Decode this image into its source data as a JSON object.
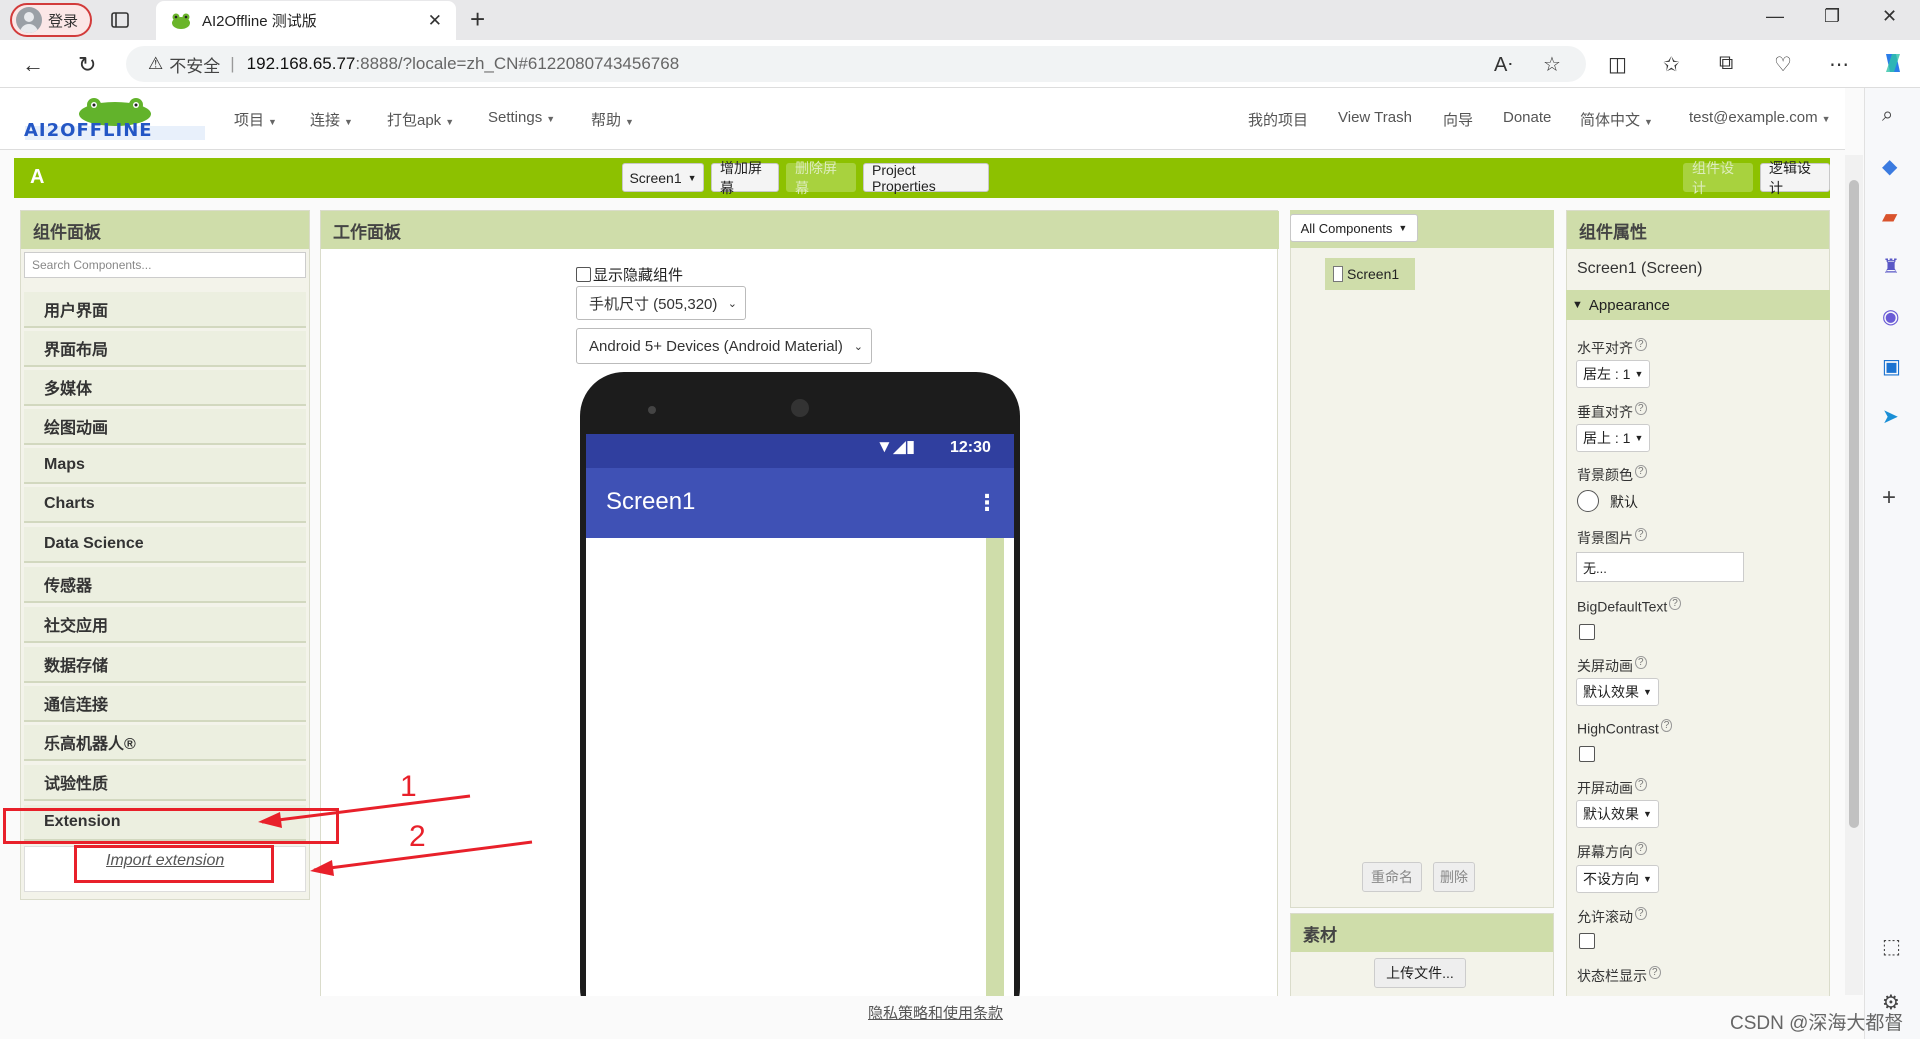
{
  "browser": {
    "profile": "登录",
    "tab_title": "AI2Offline 测试版",
    "url_insecure": "不安全",
    "url_host": "192.168.65.77",
    "url_path": ":8888/?locale=zh_CN#6122080743456768"
  },
  "appnav": {
    "logo": "AI2OFFLINE",
    "menus": [
      "项目",
      "连接",
      "打包apk",
      "Settings",
      "帮助"
    ],
    "right": [
      "我的项目",
      "View Trash",
      "向导",
      "Donate"
    ],
    "language": "简体中文",
    "user": "test@example.com"
  },
  "toolbar": {
    "project": "A",
    "screen": "Screen1",
    "add_screen": "增加屏幕",
    "remove_screen": "删除屏幕",
    "project_props": "Project Properties",
    "designer": "组件设计",
    "blocks": "逻辑设计"
  },
  "palette": {
    "title": "组件面板",
    "search_placeholder": "Search Components...",
    "categories": [
      "用户界面",
      "界面布局",
      "多媒体",
      "绘图动画",
      "Maps",
      "Charts",
      "Data Science",
      "传感器",
      "社交应用",
      "数据存储",
      "通信连接",
      "乐高机器人®",
      "试验性质",
      "Extension"
    ],
    "import": "Import extension"
  },
  "viewer": {
    "title": "工作面板",
    "show_hidden": "显示隐藏组件",
    "size": "手机尺寸 (505,320)",
    "theme": "Android 5+ Devices (Android Material)",
    "time": "12:30",
    "screen_title": "Screen1"
  },
  "tree": {
    "dropdown": "All Components",
    "item": "Screen1",
    "rename": "重命名",
    "delete": "删除"
  },
  "assets": {
    "title": "素材",
    "upload": "上传文件..."
  },
  "props": {
    "title": "组件属性",
    "component": "Screen1 (Screen)",
    "section": "Appearance",
    "align_h": "水平对齐",
    "align_h_val": "居左 : 1",
    "align_v": "垂直对齐",
    "align_v_val": "居上 : 1",
    "bgcolor": "背景颜色",
    "bgcolor_val": "默认",
    "bgimage": "背景图片",
    "bgimage_val": "无...",
    "bigtext": "BigDefaultText",
    "close_anim": "关屏动画",
    "close_anim_val": "默认效果",
    "highcontrast": "HighContrast",
    "open_anim": "开屏动画",
    "open_anim_val": "默认效果",
    "orientation": "屏幕方向",
    "orientation_val": "不设方向",
    "scroll": "允许滚动",
    "statusbar": "状态栏显示"
  },
  "footer": {
    "privacy": "隐私策略和使用条款"
  },
  "annotations": {
    "n1": "1",
    "n2": "2"
  },
  "watermark": "CSDN @深海大都督",
  "colors": {
    "toolbar": "#8dc100",
    "header": "#cfddaa",
    "android_bar": "#3f51b5",
    "annotation": "#e8202a"
  }
}
